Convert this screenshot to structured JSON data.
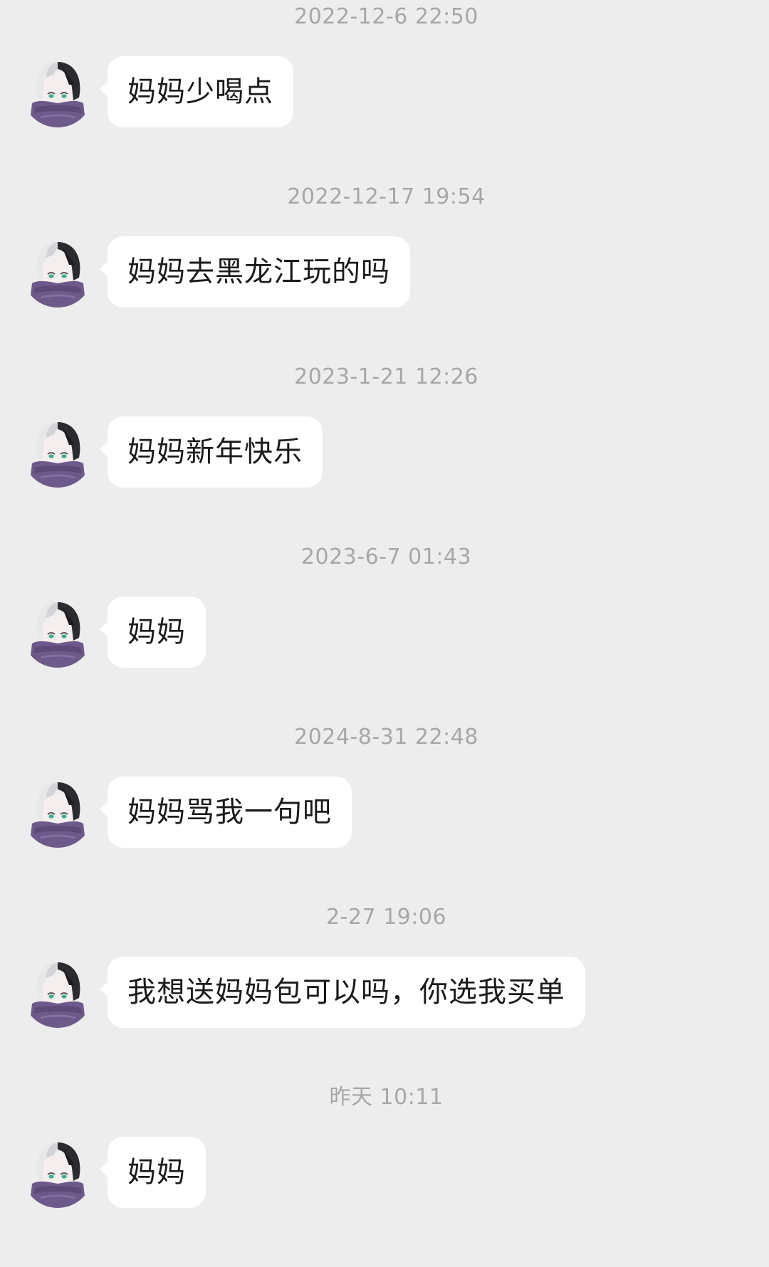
{
  "chat": {
    "messages": [
      {
        "time": "2022-12-6 22:50",
        "text": "妈妈少喝点"
      },
      {
        "time": "2022-12-17 19:54",
        "text": "妈妈去黑龙江玩的吗"
      },
      {
        "time": "2023-1-21 12:26",
        "text": "妈妈新年快乐"
      },
      {
        "time": "2023-6-7 01:43",
        "text": "妈妈"
      },
      {
        "time": "2024-8-31 22:48",
        "text": "妈妈骂我一句吧"
      },
      {
        "time": "2-27 19:06",
        "text": "我想送妈妈包可以吗，你选我买单"
      },
      {
        "time": "昨天 10:11",
        "text": "妈妈"
      }
    ]
  },
  "colors": {
    "background": "#ededed",
    "bubble": "#ffffff",
    "timestamp_text": "#a7a7a7",
    "message_text": "#1b1b1b",
    "avatar_scarf": "#6e5a8a",
    "avatar_hair_dark": "#2b2b30",
    "avatar_hair_light": "#e8e8ea",
    "avatar_eyes": "#3fae8c"
  },
  "icons": {
    "avatar": "anime-character-avatar"
  }
}
